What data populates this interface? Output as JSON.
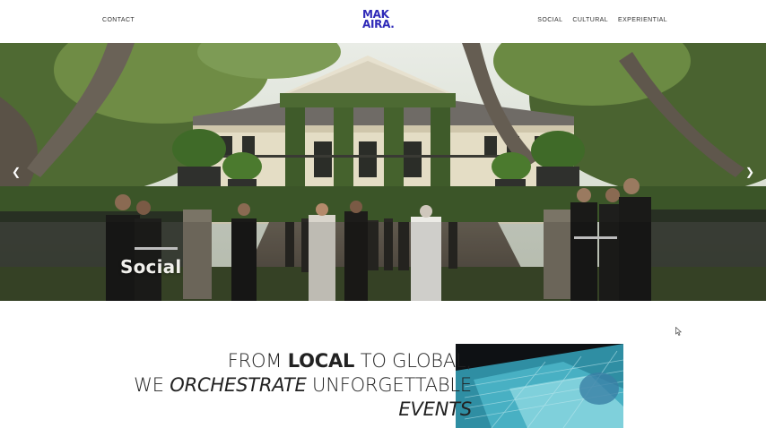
{
  "header": {
    "contact_label": "CONTACT",
    "logo_line1": "MAK",
    "logo_line2": "AIRA.",
    "nav": [
      "SOCIAL",
      "CULTURAL",
      "EXPERIENTIAL"
    ]
  },
  "hero": {
    "caption": "Social",
    "prev_icon": "chevron-left-icon",
    "next_icon": "chevron-right-icon"
  },
  "tagline": {
    "line1_a": "FROM ",
    "line1_b": "LOCAL",
    "line1_c": " TO GLOBAL,",
    "line2_a": "WE ",
    "line2_b": "ORCHESTRATE",
    "line2_c": " UNFORGETTABLE",
    "line3": "EVENTS"
  },
  "colors": {
    "brand": "#2f2ab8",
    "text": "#222222",
    "background": "#ffffff"
  }
}
